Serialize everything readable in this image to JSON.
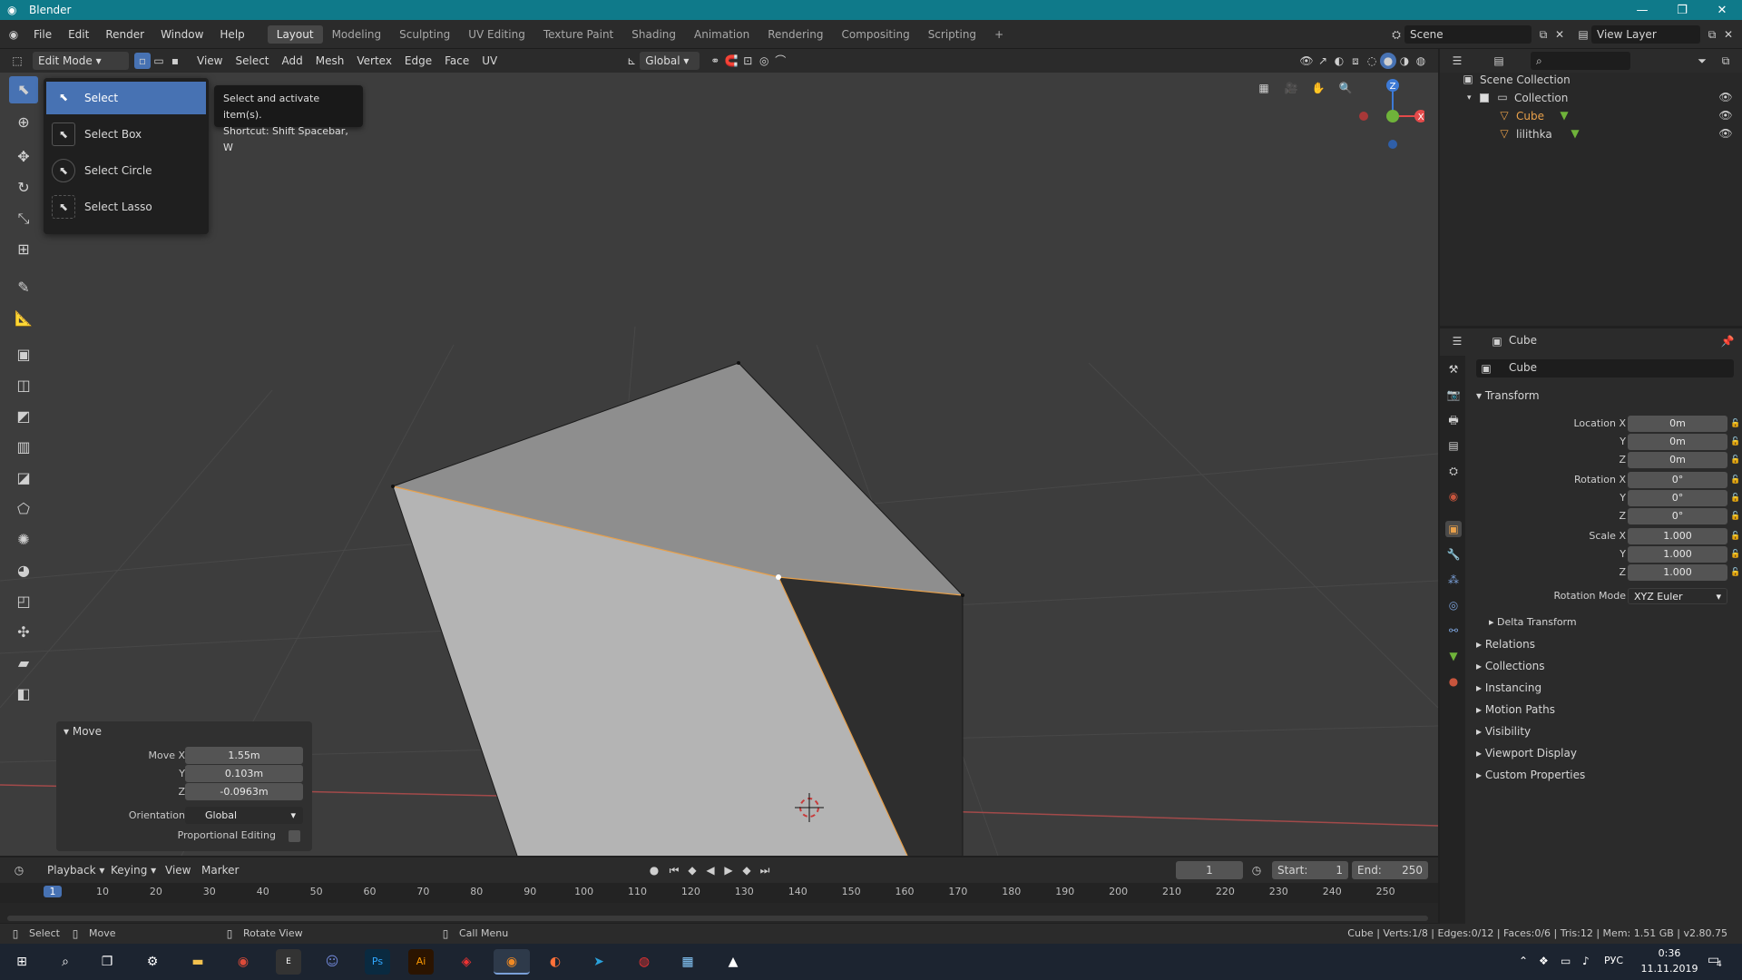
{
  "window": {
    "title": "Blender",
    "minimize": "—",
    "restore": "❐",
    "close": "✕"
  },
  "menu": [
    "File",
    "Edit",
    "Render",
    "Window",
    "Help"
  ],
  "workspaces": [
    "Layout",
    "Modeling",
    "Sculpting",
    "UV Editing",
    "Texture Paint",
    "Shading",
    "Animation",
    "Rendering",
    "Compositing",
    "Scripting",
    "+"
  ],
  "scene": {
    "name": "Scene",
    "view_layer": "View Layer"
  },
  "viewport_header": {
    "mode": "Edit Mode",
    "menus": [
      "View",
      "Select",
      "Add",
      "Mesh",
      "Vertex",
      "Edge",
      "Face",
      "UV"
    ],
    "orientation": "Global"
  },
  "select_menu": {
    "items": [
      "Select",
      "Select Box",
      "Select Circle",
      "Select Lasso"
    ],
    "tooltip_line1": "Select and activate item(s).",
    "tooltip_line2": "Shortcut: Shift Spacebar, W"
  },
  "gizmo": {
    "z": "Z",
    "y": "Y",
    "x": "X"
  },
  "move_panel": {
    "title": "Move",
    "move_x_label": "Move X",
    "move_x": "1.55m",
    "y_label": "Y",
    "y": "0.103m",
    "z_label": "Z",
    "z": "-0.0963m",
    "orientation_label": "Orientation",
    "orientation": "Global",
    "proportional_label": "Proportional Editing"
  },
  "outliner": {
    "scene_collection": "Scene Collection",
    "collection": "Collection",
    "objects": [
      "Cube",
      "lilithka"
    ]
  },
  "properties": {
    "header_object": "Cube",
    "object_name": "Cube",
    "transform": "Transform",
    "location_x_label": "Location X",
    "location_x": "0m",
    "location_y_label": "Y",
    "location_y": "0m",
    "location_z_label": "Z",
    "location_z": "0m",
    "rotation_x_label": "Rotation X",
    "rotation_x": "0°",
    "rotation_y_label": "Y",
    "rotation_y": "0°",
    "rotation_z_label": "Z",
    "rotation_z": "0°",
    "scale_x_label": "Scale X",
    "scale_x": "1.000",
    "scale_y_label": "Y",
    "scale_y": "1.000",
    "scale_z_label": "Z",
    "scale_z": "1.000",
    "rotation_mode_label": "Rotation Mode",
    "rotation_mode": "XYZ Euler",
    "delta": "Delta Transform",
    "sections": [
      "Relations",
      "Collections",
      "Instancing",
      "Motion Paths",
      "Visibility",
      "Viewport Display",
      "Custom Properties"
    ]
  },
  "timeline": {
    "menus": [
      "Playback",
      "Keying",
      "View",
      "Marker"
    ],
    "frame": "1",
    "start_label": "Start:",
    "start": "1",
    "end_label": "End:",
    "end": "250",
    "ruler": [
      "1",
      "10",
      "20",
      "30",
      "40",
      "50",
      "60",
      "70",
      "80",
      "90",
      "100",
      "110",
      "120",
      "130",
      "140",
      "150",
      "160",
      "170",
      "180",
      "190",
      "200",
      "210",
      "220",
      "230",
      "240",
      "250"
    ]
  },
  "statusbar": {
    "select": "Select",
    "move": "Move",
    "rotate": "Rotate View",
    "call_menu": "Call Menu",
    "stats": "Cube | Verts:1/8 | Edges:0/12 | Faces:0/6 | Tris:12 | Mem: 1.51 GB | v2.80.75"
  },
  "taskbar": {
    "lang": "РУС",
    "time": "0:36",
    "date": "11.11.2019",
    "notif": "4"
  },
  "colors": {
    "accent": "#4772b3",
    "titlebar": "#0f7a8a",
    "viewport": "#3d3d3d",
    "x_axis": "#e34a4a",
    "y_axis": "#6fb33a",
    "z_axis": "#3d7ad6",
    "selected": "#e8a04a"
  }
}
